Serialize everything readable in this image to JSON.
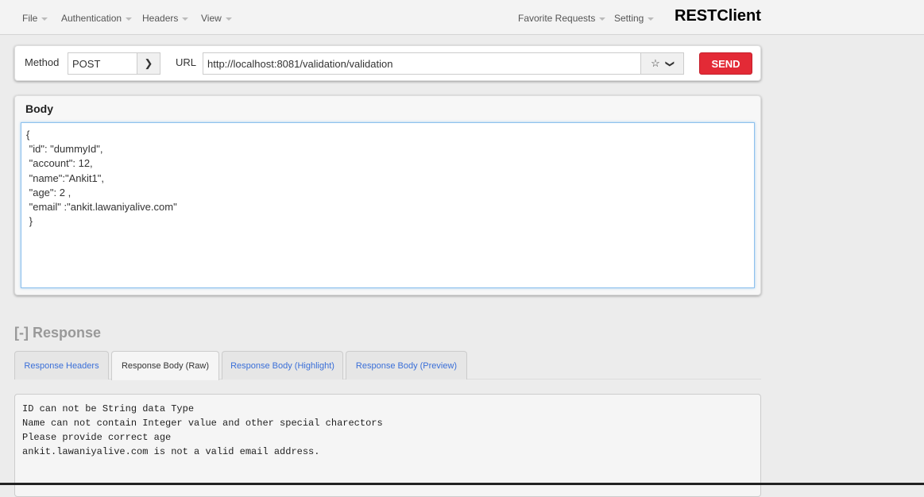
{
  "menu": {
    "left": [
      "File",
      "Authentication",
      "Headers",
      "View"
    ],
    "right": [
      "Favorite Requests",
      "Setting"
    ],
    "brand": "RESTClient"
  },
  "request": {
    "method_label": "Method",
    "method": "POST",
    "url_label": "URL",
    "url": "http://localhost:8081/validation/validation",
    "send": "SEND"
  },
  "body": {
    "title": "Body",
    "lines": [
      "{",
      " \"id\": \"dummyId\",",
      " \"account\": 12,",
      " \"name\":\"Ankit1\",",
      " \"age\": 2 ,",
      " \"email\" :\"ankit.lawaniyalive.com\"",
      " }"
    ]
  },
  "response": {
    "title": "[-] Response",
    "tabs": [
      "Response Headers",
      "Response Body (Raw)",
      "Response Body (Highlight)",
      "Response Body (Preview)"
    ],
    "active_tab": 1,
    "lines": [
      "ID can not be String data Type",
      "Name can not contain Integer value and other special charectors",
      "Please provide correct age",
      "ankit.lawaniyalive.com is not a valid email address."
    ]
  },
  "colors": {
    "send": "#e32a36",
    "link": "#3a6fd8"
  }
}
